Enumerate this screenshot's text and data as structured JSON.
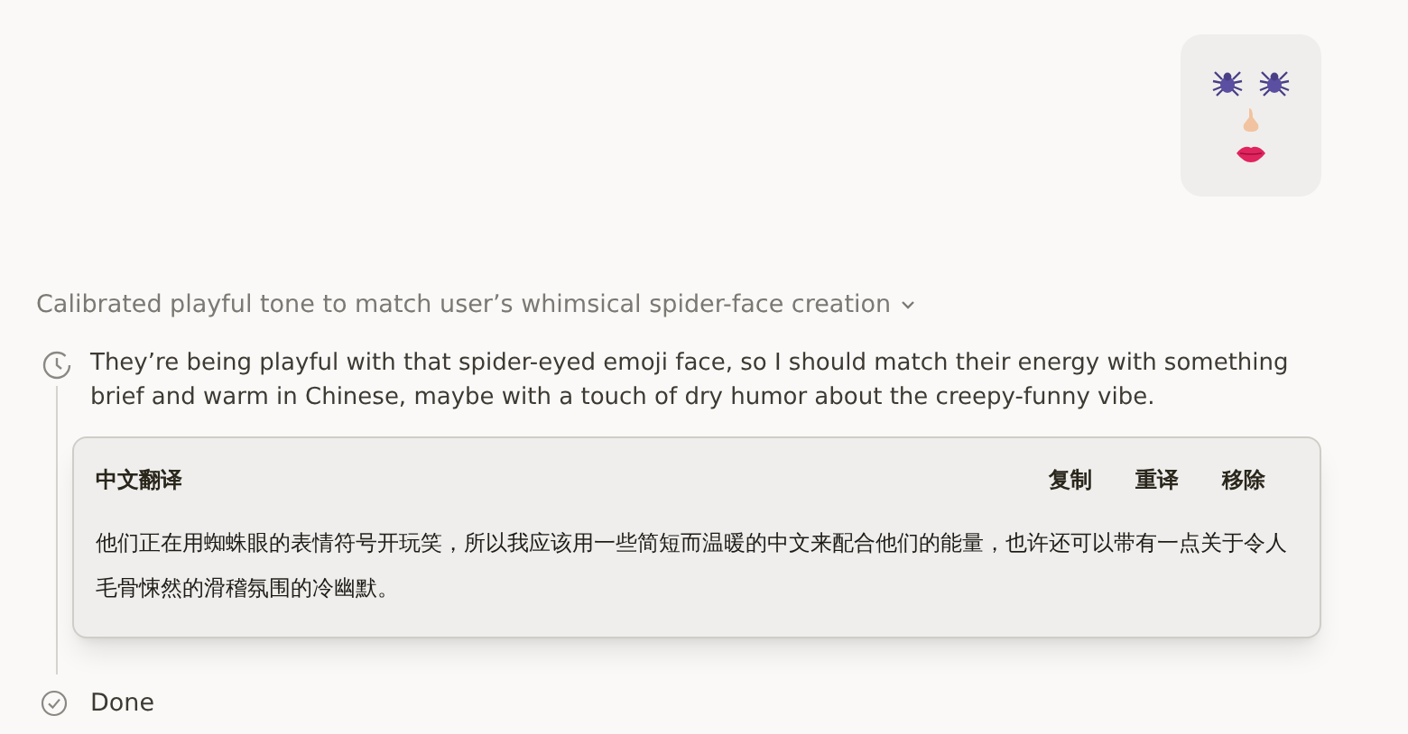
{
  "user_message": {
    "kind": "emoji-face"
  },
  "thinking": {
    "summary": "Calibrated playful tone to match user’s whimsical spider-face creation",
    "expanded": true,
    "thought": "They’re being playful with that spider-eyed emoji face, so I should match their energy with something brief and warm in Chinese, maybe with a touch of dry humor about the creepy-funny vibe.",
    "translation": {
      "title": "中文翻译",
      "actions": [
        "复制",
        "重译",
        "移除"
      ],
      "text": "他们正在用蜘蛛眼的表情符号开玩笑，所以我应该用一些简短而温暖的中文来配合他们的能量，也许还可以带有一点关于令人毛骨悚然的滑稽氛围的冷幽默。"
    },
    "status": "Done"
  }
}
